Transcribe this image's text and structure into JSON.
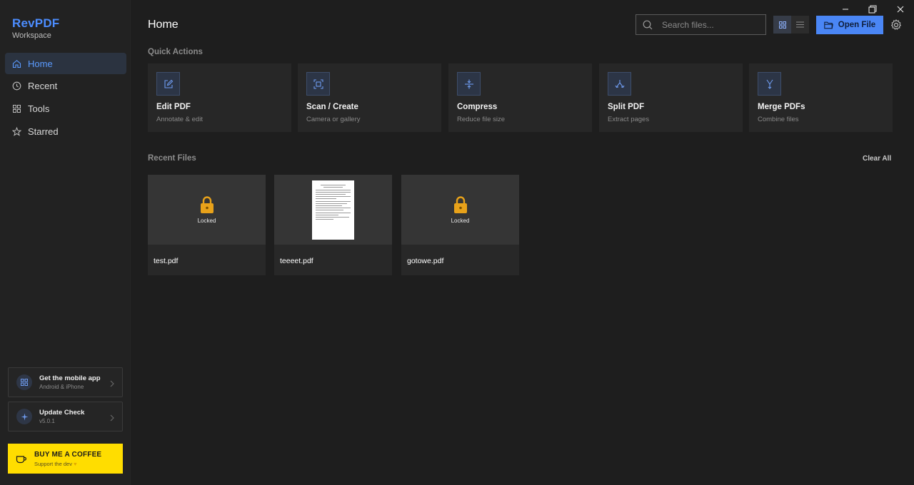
{
  "brand": {
    "name": "RevPDF",
    "subtitle": "Workspace"
  },
  "sidebar": {
    "items": [
      {
        "label": "Home",
        "icon": "home-icon",
        "active": true
      },
      {
        "label": "Recent",
        "icon": "clock-icon",
        "active": false
      },
      {
        "label": "Tools",
        "icon": "grid-icon",
        "active": false
      },
      {
        "label": "Starred",
        "icon": "star-icon",
        "active": false
      }
    ],
    "promos": [
      {
        "title": "Get the mobile app",
        "subtitle": "Android & iPhone",
        "icon": "qr-icon"
      },
      {
        "title": "Update Check",
        "subtitle": "v5.0.1",
        "icon": "sparkle-icon"
      }
    ],
    "coffee": {
      "title": "BUY ME A COFFEE",
      "subtitle": "Support the dev",
      "icon": "coffee-cup-icon"
    }
  },
  "header": {
    "title": "Home",
    "search_placeholder": "Search files...",
    "open_file_label": "Open File",
    "view_mode": "grid"
  },
  "quick_actions": {
    "title": "Quick Actions",
    "items": [
      {
        "title": "Edit PDF",
        "subtitle": "Annotate & edit",
        "icon": "edit-icon"
      },
      {
        "title": "Scan / Create",
        "subtitle": "Camera or gallery",
        "icon": "scan-icon"
      },
      {
        "title": "Compress",
        "subtitle": "Reduce file size",
        "icon": "compress-icon"
      },
      {
        "title": "Split PDF",
        "subtitle": "Extract pages",
        "icon": "split-icon"
      },
      {
        "title": "Merge PDFs",
        "subtitle": "Combine files",
        "icon": "merge-icon"
      }
    ]
  },
  "recent_files": {
    "title": "Recent Files",
    "clear_label": "Clear All",
    "items": [
      {
        "name": "test.pdf",
        "locked": true,
        "lock_label": "Locked"
      },
      {
        "name": "teeeet.pdf",
        "locked": false
      },
      {
        "name": "gotowe.pdf",
        "locked": true,
        "lock_label": "Locked"
      }
    ]
  },
  "colors": {
    "accent": "#4a86f5",
    "brand": "#4c8dff",
    "coffee": "#ffdd00",
    "lock": "#e8a21a"
  }
}
